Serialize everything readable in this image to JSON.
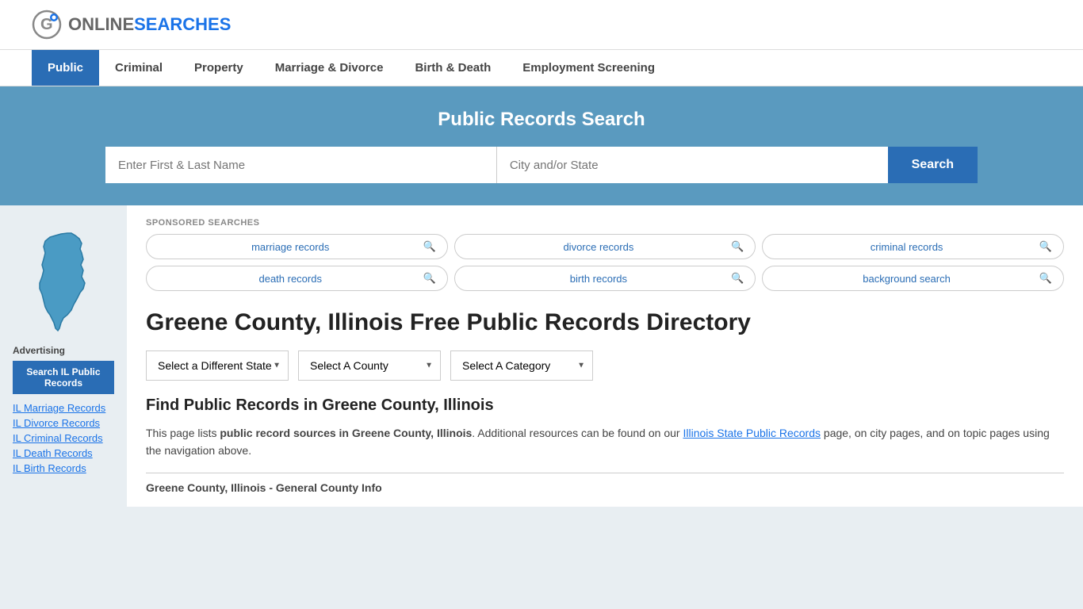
{
  "header": {
    "logo_online": "ONLINE",
    "logo_searches": "SEARCHES"
  },
  "nav": {
    "items": [
      {
        "label": "Public",
        "active": true
      },
      {
        "label": "Criminal",
        "active": false
      },
      {
        "label": "Property",
        "active": false
      },
      {
        "label": "Marriage & Divorce",
        "active": false
      },
      {
        "label": "Birth & Death",
        "active": false
      },
      {
        "label": "Employment Screening",
        "active": false
      }
    ]
  },
  "hero": {
    "title": "Public Records Search",
    "name_placeholder": "Enter First & Last Name",
    "location_placeholder": "City and/or State",
    "search_button": "Search"
  },
  "sponsored": {
    "label": "SPONSORED SEARCHES",
    "tags": [
      {
        "text": "marriage records"
      },
      {
        "text": "divorce records"
      },
      {
        "text": "criminal records"
      },
      {
        "text": "death records"
      },
      {
        "text": "birth records"
      },
      {
        "text": "background search"
      }
    ]
  },
  "page": {
    "title": "Greene County, Illinois Free Public Records Directory"
  },
  "dropdowns": {
    "state": "Select a Different State",
    "county": "Select A County",
    "category": "Select A Category"
  },
  "find": {
    "title": "Find Public Records in Greene County, Illinois",
    "text_before": "This page lists ",
    "bold_text": "public record sources in Greene County, Illinois",
    "text_middle": ". Additional resources can be found on our ",
    "link_text": "Illinois State Public Records",
    "text_after": " page, on city pages, and on topic pages using the navigation above."
  },
  "section_divider": {
    "title": "Greene County, Illinois - General County Info"
  },
  "sidebar": {
    "advertising_label": "Advertising",
    "ad_button": "Search IL Public Records",
    "links": [
      {
        "text": "IL Marriage Records"
      },
      {
        "text": "IL Divorce Records"
      },
      {
        "text": "IL Criminal Records"
      },
      {
        "text": "IL Death Records"
      },
      {
        "text": "IL Birth Records"
      }
    ]
  }
}
